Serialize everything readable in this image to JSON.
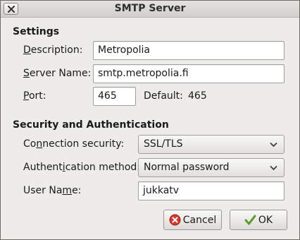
{
  "window": {
    "title": "SMTP Server"
  },
  "settings": {
    "heading": "Settings",
    "description_label_u": "D",
    "description_label_rest": "escription:",
    "description_value": "Metropolia",
    "server_label_u": "S",
    "server_label_rest": "erver Name:",
    "server_value": "smtp.metropolia.fi",
    "port_label_u": "P",
    "port_label_rest": "ort:",
    "port_value": "465",
    "default_label": "Default:",
    "default_value": "465"
  },
  "security": {
    "heading": "Security and Authentication",
    "connection_label_pre": "Co",
    "connection_label_u": "n",
    "connection_label_rest": "nection security:",
    "connection_value": "SSL/TLS",
    "auth_label_pre": "Authent",
    "auth_label_u": "i",
    "auth_label_rest": "cation method:",
    "auth_value": "Normal password",
    "username_label_pre": "User Na",
    "username_label_u": "m",
    "username_label_rest": "e:",
    "username_value": "jukkatv"
  },
  "buttons": {
    "cancel_label": "Cancel",
    "ok_label": "OK"
  },
  "icons": {
    "close": "close-icon",
    "cancel": "cancel-icon",
    "ok": "checkmark-icon",
    "dropdown": "chevron-down-icon"
  },
  "colors": {
    "cancel_icon": "#d63a2e",
    "ok_icon": "#5a9a24"
  }
}
